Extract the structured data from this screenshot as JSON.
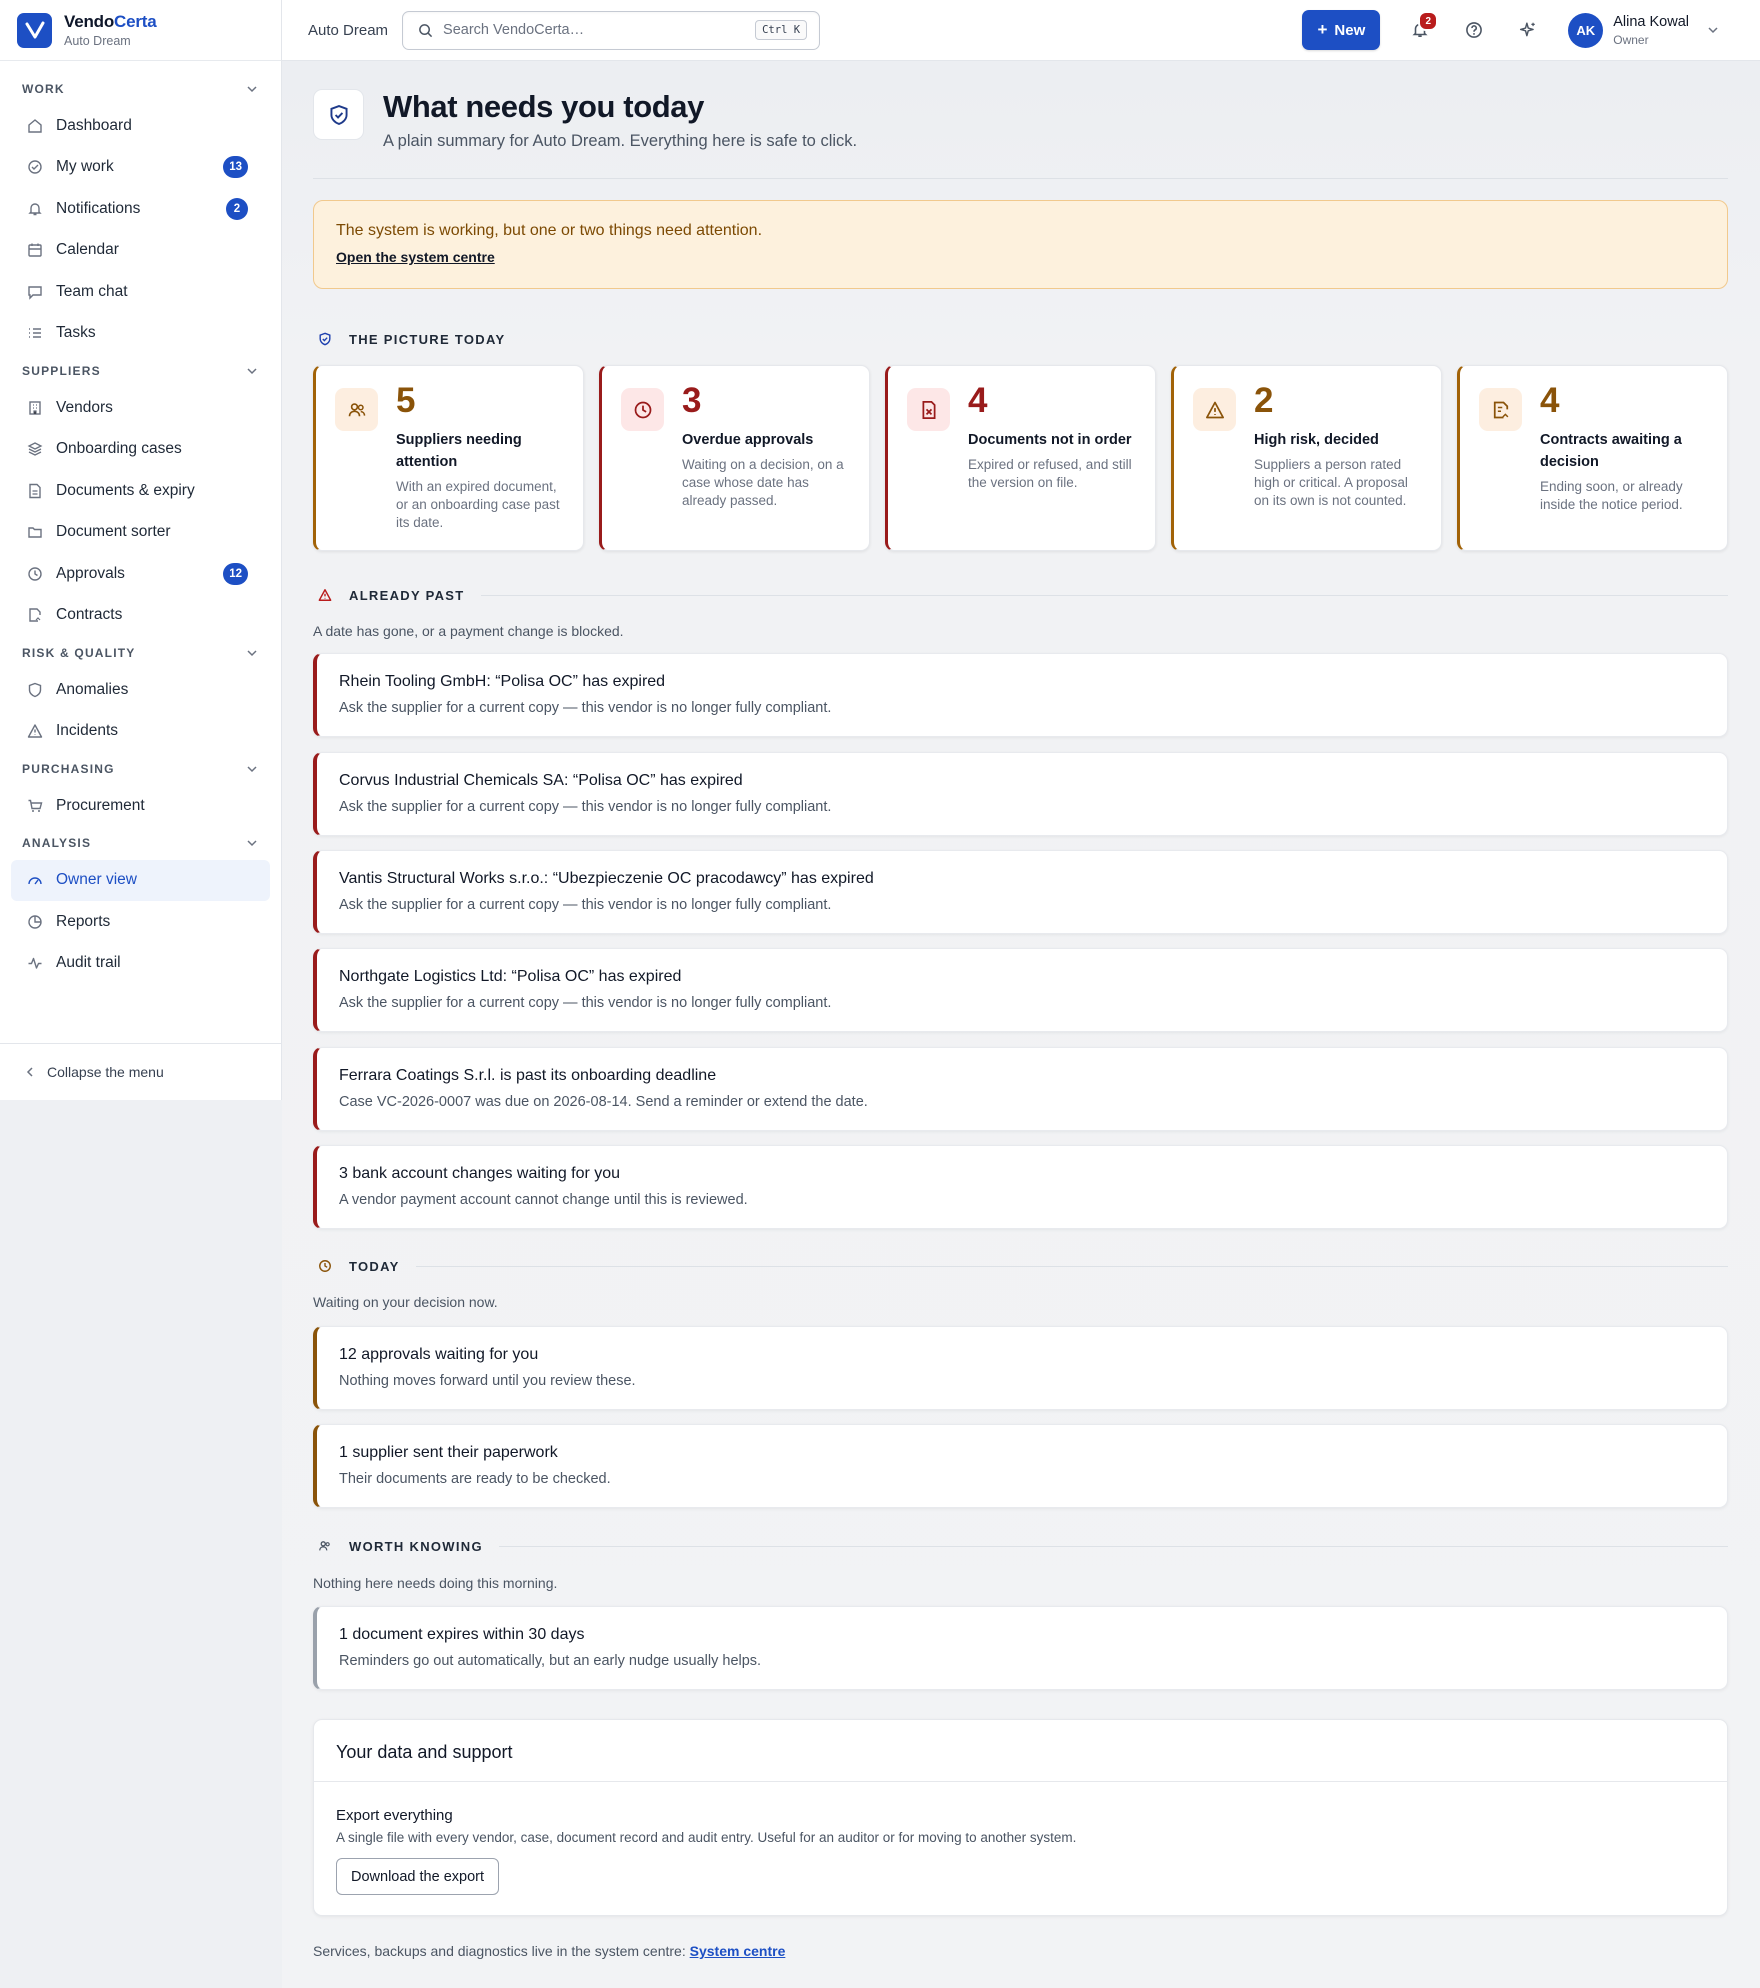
{
  "brand": {
    "name_part1": "Vendo",
    "name_part2": "Certa",
    "workspace": "Auto Dream"
  },
  "sidebar": {
    "sections": [
      {
        "label": "WORK",
        "items": [
          {
            "label": "Dashboard",
            "icon": "home-icon"
          },
          {
            "label": "My work",
            "icon": "check-circle-icon",
            "count": "13"
          },
          {
            "label": "Notifications",
            "icon": "bell-icon",
            "count": "2"
          },
          {
            "label": "Calendar",
            "icon": "calendar-icon"
          },
          {
            "label": "Team chat",
            "icon": "chat-icon"
          },
          {
            "label": "Tasks",
            "icon": "list-icon"
          }
        ]
      },
      {
        "label": "SUPPLIERS",
        "items": [
          {
            "label": "Vendors",
            "icon": "building-icon"
          },
          {
            "label": "Onboarding cases",
            "icon": "layers-icon"
          },
          {
            "label": "Documents & expiry",
            "icon": "document-icon"
          },
          {
            "label": "Document sorter",
            "icon": "folder-icon"
          },
          {
            "label": "Approvals",
            "icon": "clock-icon",
            "count": "12"
          },
          {
            "label": "Contracts",
            "icon": "contract-icon"
          }
        ]
      },
      {
        "label": "RISK & QUALITY",
        "items": [
          {
            "label": "Anomalies",
            "icon": "shield-icon"
          },
          {
            "label": "Incidents",
            "icon": "warning-icon"
          }
        ]
      },
      {
        "label": "PURCHASING",
        "items": [
          {
            "label": "Procurement",
            "icon": "cart-icon"
          }
        ]
      },
      {
        "label": "ANALYSIS",
        "items": [
          {
            "label": "Owner view",
            "icon": "gauge-icon",
            "active": true
          },
          {
            "label": "Reports",
            "icon": "pie-chart-icon"
          },
          {
            "label": "Audit trail",
            "icon": "activity-icon"
          }
        ]
      }
    ],
    "collapse_label": "Collapse the menu"
  },
  "topbar": {
    "workspace": "Auto Dream",
    "search_placeholder": "Search VendoCerta…",
    "shortcut": "Ctrl K",
    "new_label": "New",
    "notif_count": "2",
    "user": {
      "initials": "AK",
      "name": "Alina Kowal",
      "role": "Owner"
    }
  },
  "page": {
    "title": "What needs you today",
    "subtitle": "A plain summary for Auto Dream. Everything here is safe to click."
  },
  "alert": {
    "message": "The system is working, but one or two things need attention.",
    "link": "Open the system centre"
  },
  "picture": {
    "title": "THE PICTURE TODAY",
    "cards": [
      {
        "value": "5",
        "title": "Suppliers needing attention",
        "desc": "With an expired document, or an onboarding case past its date.",
        "tone": "amber",
        "icon": "users-icon"
      },
      {
        "value": "3",
        "title": "Overdue approvals",
        "desc": "Waiting on a decision, on a case whose date has already passed.",
        "tone": "red",
        "icon": "clock-icon"
      },
      {
        "value": "4",
        "title": "Documents not in order",
        "desc": "Expired or refused, and still the version on file.",
        "tone": "red",
        "icon": "file-x-icon"
      },
      {
        "value": "2",
        "title": "High risk, decided",
        "desc": "Suppliers a person rated high or critical. A proposal on its own is not counted.",
        "tone": "amber",
        "icon": "warning-icon"
      },
      {
        "value": "4",
        "title": "Contracts awaiting a decision",
        "desc": "Ending soon, or already inside the notice period.",
        "tone": "amber",
        "icon": "contract-icon"
      }
    ]
  },
  "past": {
    "title": "ALREADY PAST",
    "subtitle": "A date has gone, or a payment change is blocked.",
    "items": [
      {
        "title": "Rhein Tooling GmbH: “Polisa OC” has expired",
        "desc": "Ask the supplier for a current copy — this vendor is no longer fully compliant."
      },
      {
        "title": "Corvus Industrial Chemicals SA: “Polisa OC” has expired",
        "desc": "Ask the supplier for a current copy — this vendor is no longer fully compliant."
      },
      {
        "title": "Vantis Structural Works s.r.o.: “Ubezpieczenie OC pracodawcy” has expired",
        "desc": "Ask the supplier for a current copy — this vendor is no longer fully compliant."
      },
      {
        "title": "Northgate Logistics Ltd: “Polisa OC” has expired",
        "desc": "Ask the supplier for a current copy — this vendor is no longer fully compliant."
      },
      {
        "title": "Ferrara Coatings S.r.l. is past its onboarding deadline",
        "desc": "Case VC-2026-0007 was due on 2026-08-14. Send a reminder or extend the date."
      },
      {
        "title": "3 bank account changes waiting for you",
        "desc": "A vendor payment account cannot change until this is reviewed."
      }
    ]
  },
  "today": {
    "title": "TODAY",
    "subtitle": "Waiting on your decision now.",
    "items": [
      {
        "title": "12 approvals waiting for you",
        "desc": "Nothing moves forward until you review these."
      },
      {
        "title": "1 supplier sent their paperwork",
        "desc": "Their documents are ready to be checked."
      }
    ]
  },
  "worth": {
    "title": "WORTH KNOWING",
    "subtitle": "Nothing here needs doing this morning.",
    "items": [
      {
        "title": "1 document expires within 30 days",
        "desc": "Reminders go out automatically, but an early nudge usually helps."
      }
    ]
  },
  "support": {
    "title": "Your data and support",
    "export_title": "Export everything",
    "export_desc": "A single file with every vendor, case, document record and audit entry. Useful for an auditor or for moving to another system.",
    "button": "Download the export"
  },
  "footer": {
    "text": "Services, backups and diagnostics live in the system centre: ",
    "link": "System centre"
  },
  "colors": {
    "accent": "#1d4fc4",
    "danger": "#991b1b",
    "warning": "#8a5309",
    "alert_bg": "#fdf1dd"
  }
}
